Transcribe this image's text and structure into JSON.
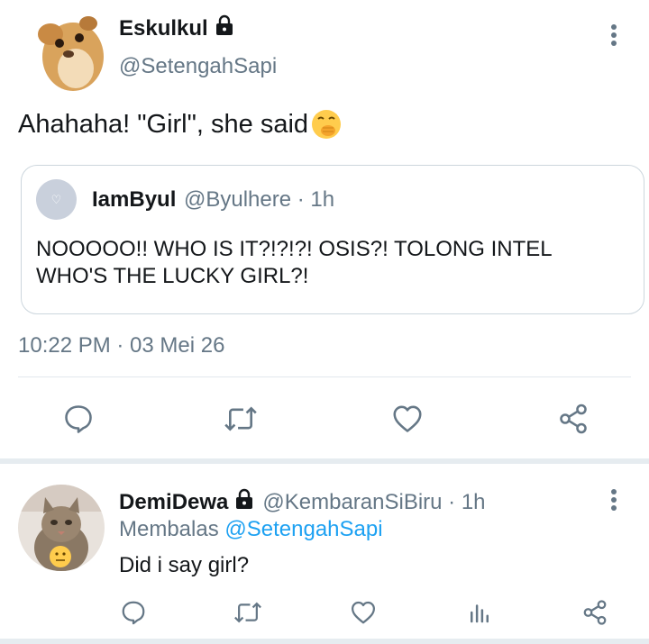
{
  "tweet": {
    "author_name": "Eskulkul",
    "author_handle": "@SetengahSapi",
    "text": "Ahahaha! \"Girl\", she said",
    "text_emoji": "face-with-hand-over-mouth",
    "timestamp": "10:22 PM · 03 Mei 26",
    "quoted": {
      "author_name": "IamByul",
      "author_handle": "@Byulhere · 1h",
      "text": "NOOOOO!! WHO IS IT?!?!?! OSIS?! TOLONG INTEL WHO'S THE LUCKY GIRL?!"
    },
    "actions": [
      "reply-icon",
      "retweet-icon",
      "like-icon",
      "share-icon"
    ]
  },
  "reply": {
    "author_name": "DemiDewa",
    "author_handle": "@KembaranSiBiru · 1h",
    "replying_to_prefix": "Membalas",
    "replying_to_handle": "@SetengahSapi",
    "text": "Did i say girl?",
    "actions": [
      "reply-icon",
      "retweet-icon",
      "like-icon",
      "analytics-icon",
      "share-icon"
    ]
  },
  "colors": {
    "text": "#14171a",
    "secondary": "#657786",
    "link": "#1da1f2",
    "border": "#ccd6dd",
    "icon": "#657786"
  }
}
